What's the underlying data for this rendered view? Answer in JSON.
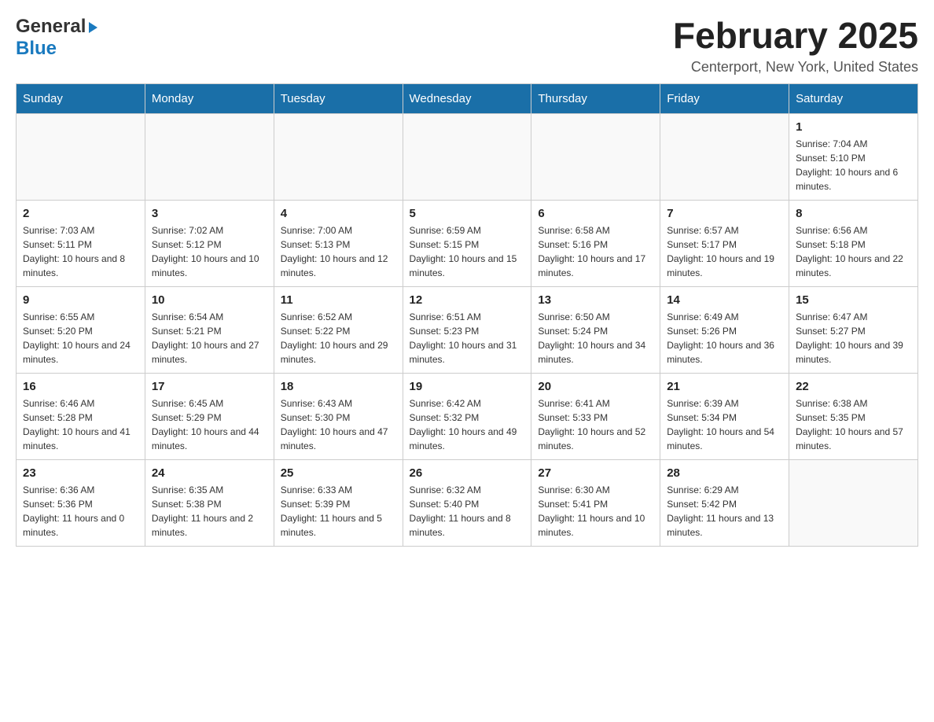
{
  "header": {
    "logo_general": "General",
    "logo_blue": "Blue",
    "month_title": "February 2025",
    "location": "Centerport, New York, United States"
  },
  "weekdays": [
    "Sunday",
    "Monday",
    "Tuesday",
    "Wednesday",
    "Thursday",
    "Friday",
    "Saturday"
  ],
  "weeks": [
    [
      {
        "day": "",
        "info": ""
      },
      {
        "day": "",
        "info": ""
      },
      {
        "day": "",
        "info": ""
      },
      {
        "day": "",
        "info": ""
      },
      {
        "day": "",
        "info": ""
      },
      {
        "day": "",
        "info": ""
      },
      {
        "day": "1",
        "info": "Sunrise: 7:04 AM\nSunset: 5:10 PM\nDaylight: 10 hours and 6 minutes."
      }
    ],
    [
      {
        "day": "2",
        "info": "Sunrise: 7:03 AM\nSunset: 5:11 PM\nDaylight: 10 hours and 8 minutes."
      },
      {
        "day": "3",
        "info": "Sunrise: 7:02 AM\nSunset: 5:12 PM\nDaylight: 10 hours and 10 minutes."
      },
      {
        "day": "4",
        "info": "Sunrise: 7:00 AM\nSunset: 5:13 PM\nDaylight: 10 hours and 12 minutes."
      },
      {
        "day": "5",
        "info": "Sunrise: 6:59 AM\nSunset: 5:15 PM\nDaylight: 10 hours and 15 minutes."
      },
      {
        "day": "6",
        "info": "Sunrise: 6:58 AM\nSunset: 5:16 PM\nDaylight: 10 hours and 17 minutes."
      },
      {
        "day": "7",
        "info": "Sunrise: 6:57 AM\nSunset: 5:17 PM\nDaylight: 10 hours and 19 minutes."
      },
      {
        "day": "8",
        "info": "Sunrise: 6:56 AM\nSunset: 5:18 PM\nDaylight: 10 hours and 22 minutes."
      }
    ],
    [
      {
        "day": "9",
        "info": "Sunrise: 6:55 AM\nSunset: 5:20 PM\nDaylight: 10 hours and 24 minutes."
      },
      {
        "day": "10",
        "info": "Sunrise: 6:54 AM\nSunset: 5:21 PM\nDaylight: 10 hours and 27 minutes."
      },
      {
        "day": "11",
        "info": "Sunrise: 6:52 AM\nSunset: 5:22 PM\nDaylight: 10 hours and 29 minutes."
      },
      {
        "day": "12",
        "info": "Sunrise: 6:51 AM\nSunset: 5:23 PM\nDaylight: 10 hours and 31 minutes."
      },
      {
        "day": "13",
        "info": "Sunrise: 6:50 AM\nSunset: 5:24 PM\nDaylight: 10 hours and 34 minutes."
      },
      {
        "day": "14",
        "info": "Sunrise: 6:49 AM\nSunset: 5:26 PM\nDaylight: 10 hours and 36 minutes."
      },
      {
        "day": "15",
        "info": "Sunrise: 6:47 AM\nSunset: 5:27 PM\nDaylight: 10 hours and 39 minutes."
      }
    ],
    [
      {
        "day": "16",
        "info": "Sunrise: 6:46 AM\nSunset: 5:28 PM\nDaylight: 10 hours and 41 minutes."
      },
      {
        "day": "17",
        "info": "Sunrise: 6:45 AM\nSunset: 5:29 PM\nDaylight: 10 hours and 44 minutes."
      },
      {
        "day": "18",
        "info": "Sunrise: 6:43 AM\nSunset: 5:30 PM\nDaylight: 10 hours and 47 minutes."
      },
      {
        "day": "19",
        "info": "Sunrise: 6:42 AM\nSunset: 5:32 PM\nDaylight: 10 hours and 49 minutes."
      },
      {
        "day": "20",
        "info": "Sunrise: 6:41 AM\nSunset: 5:33 PM\nDaylight: 10 hours and 52 minutes."
      },
      {
        "day": "21",
        "info": "Sunrise: 6:39 AM\nSunset: 5:34 PM\nDaylight: 10 hours and 54 minutes."
      },
      {
        "day": "22",
        "info": "Sunrise: 6:38 AM\nSunset: 5:35 PM\nDaylight: 10 hours and 57 minutes."
      }
    ],
    [
      {
        "day": "23",
        "info": "Sunrise: 6:36 AM\nSunset: 5:36 PM\nDaylight: 11 hours and 0 minutes."
      },
      {
        "day": "24",
        "info": "Sunrise: 6:35 AM\nSunset: 5:38 PM\nDaylight: 11 hours and 2 minutes."
      },
      {
        "day": "25",
        "info": "Sunrise: 6:33 AM\nSunset: 5:39 PM\nDaylight: 11 hours and 5 minutes."
      },
      {
        "day": "26",
        "info": "Sunrise: 6:32 AM\nSunset: 5:40 PM\nDaylight: 11 hours and 8 minutes."
      },
      {
        "day": "27",
        "info": "Sunrise: 6:30 AM\nSunset: 5:41 PM\nDaylight: 11 hours and 10 minutes."
      },
      {
        "day": "28",
        "info": "Sunrise: 6:29 AM\nSunset: 5:42 PM\nDaylight: 11 hours and 13 minutes."
      },
      {
        "day": "",
        "info": ""
      }
    ]
  ]
}
